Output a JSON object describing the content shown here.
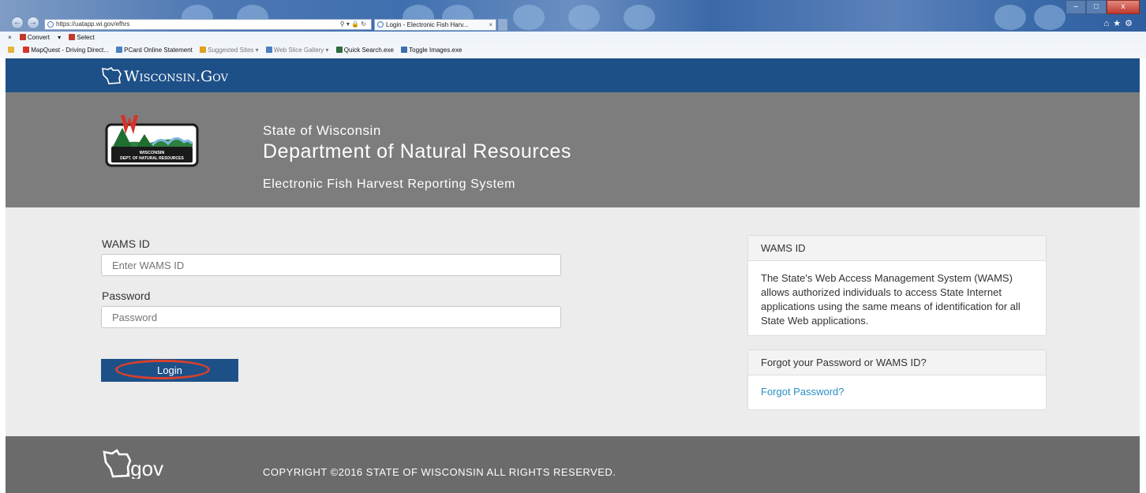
{
  "browser": {
    "url": "https://uatapp.wi.gov/efhrs",
    "tab_title": "Login - Electronic Fish Harv...",
    "tab_close": "×",
    "command_bar": [
      "Convert",
      "Select"
    ],
    "favorites": [
      "MapQuest - Driving Direct...",
      "PCard Online Statement",
      "Suggested Sites",
      "Web Slice Gallery",
      "Quick Search.exe",
      "Toggle Images.exe"
    ],
    "close_x": "×",
    "min_label": "–",
    "max_label": "□",
    "cls_label": "x"
  },
  "header": {
    "brand": "Wisconsin.Gov",
    "subtitle": "State of Wisconsin",
    "title": "Department of Natural Resources",
    "system": "Electronic Fish Harvest Reporting System",
    "logo_text_1": "WISCONSIN",
    "logo_text_2": "DEPT. OF NATURAL RESOURCES"
  },
  "login": {
    "wams_label": "WAMS ID",
    "wams_placeholder": "Enter WAMS ID",
    "password_label": "Password",
    "password_placeholder": "Password",
    "login_button": "Login"
  },
  "info_panel": {
    "heading": "WAMS ID",
    "body": "The State's Web Access Management System (WAMS) allows authorized individuals to access State Internet applications using the same means of identification for all State Web applications."
  },
  "forgot_panel": {
    "heading": "Forgot your Password or WAMS ID?",
    "link": "Forgot Password?"
  },
  "footer": {
    "logo_text": ".gov",
    "copyright": "COPYRIGHT ©2016 STATE OF WISCONSIN ALL RIGHTS RESERVED."
  },
  "colors": {
    "header_blue": "#1e5088",
    "hero_gray": "#7d7d7d",
    "footer_gray": "#6b6b6b",
    "link_blue": "#2a8fc5",
    "highlight_red": "#d9402b"
  }
}
